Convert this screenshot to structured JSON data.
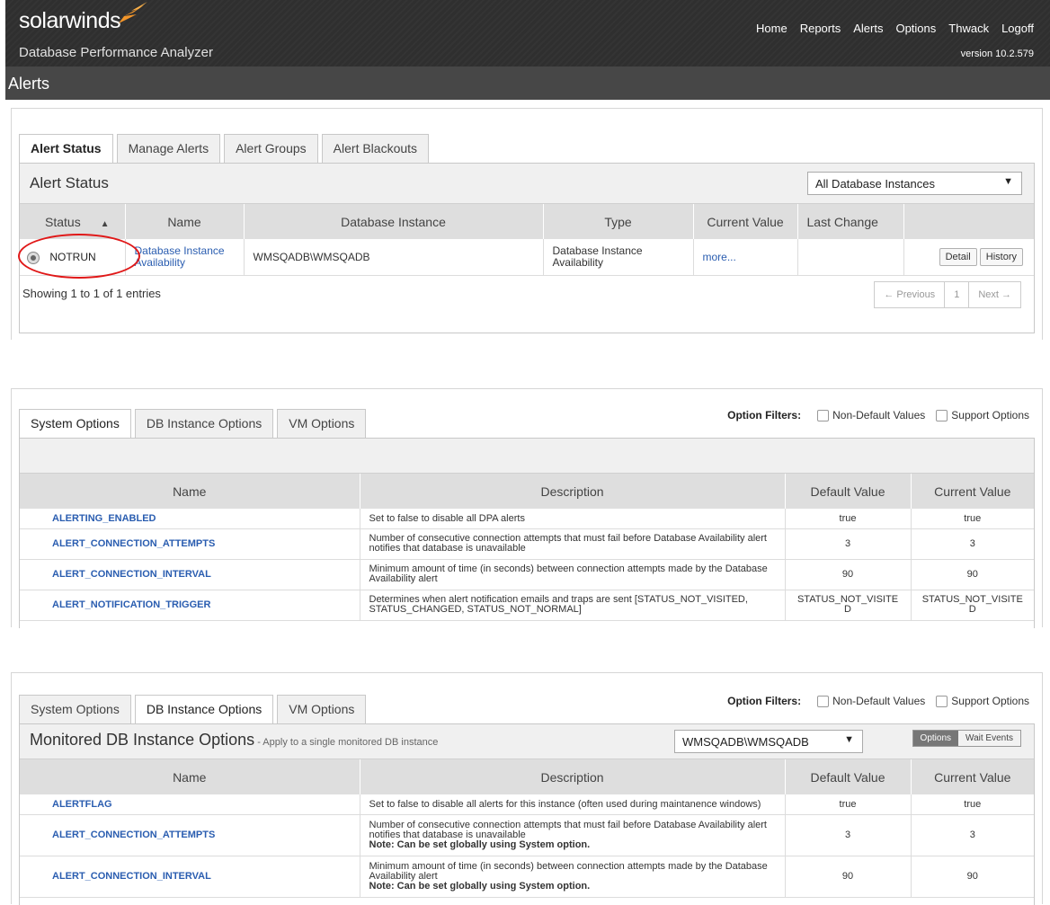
{
  "header": {
    "brand": "solarwinds",
    "product": "Database Performance Analyzer",
    "nav": [
      "Home",
      "Reports",
      "Alerts",
      "Options",
      "Thwack",
      "Logoff"
    ],
    "version": "version 10.2.579",
    "page_title": "Alerts",
    "colors": {
      "brand_flame": "#f3962a",
      "header_bg": "#2f2f2f"
    }
  },
  "alerts_panel": {
    "tabs": [
      "Alert Status",
      "Manage Alerts",
      "Alert Groups",
      "Alert Blackouts"
    ],
    "title": "Alert Status",
    "instance_filter": "All Database Instances",
    "columns": [
      "Status",
      "Name",
      "Database Instance",
      "Type",
      "Current Value",
      "Last Change",
      ""
    ],
    "row": {
      "status": "NOTRUN",
      "name": "Database Instance Availability",
      "instance": "WMSQADB\\WMSQADB",
      "type": "Database Instance Availability",
      "current_value": "more...",
      "last_change": "",
      "detail_label": "Detail",
      "history_label": "History"
    },
    "showing": "Showing 1 to 1 of 1 entries",
    "pager": {
      "previous": "← Previous",
      "page": "1",
      "next": "Next →"
    }
  },
  "system_options": {
    "tabs": [
      "System Options",
      "DB Instance Options",
      "VM Options"
    ],
    "filters_label": "Option Filters:",
    "filter_non_default": "Non-Default Values",
    "filter_support": "Support Options",
    "columns": [
      "Name",
      "Description",
      "Default Value",
      "Current Value"
    ],
    "rows": [
      {
        "name": "ALERTING_ENABLED",
        "desc": "Set to false to disable all DPA alerts",
        "default": "true",
        "current": "true"
      },
      {
        "name": "ALERT_CONNECTION_ATTEMPTS",
        "desc": "Number of consecutive connection attempts that must fail before Database Availability alert notifies that database is unavailable",
        "default": "3",
        "current": "3"
      },
      {
        "name": "ALERT_CONNECTION_INTERVAL",
        "desc": "Minimum amount of time (in seconds) between connection attempts made by the Database Availability alert",
        "default": "90",
        "current": "90"
      },
      {
        "name": "ALERT_NOTIFICATION_TRIGGER",
        "desc": "Determines when alert notification emails and traps are sent [STATUS_NOT_VISITED, STATUS_CHANGED, STATUS_NOT_NORMAL]",
        "default": "STATUS_NOT_VISITE D",
        "current": "STATUS_NOT_VISITE D"
      }
    ]
  },
  "db_options": {
    "tabs": [
      "System Options",
      "DB Instance Options",
      "VM Options"
    ],
    "filters_label": "Option Filters:",
    "filter_non_default": "Non-Default Values",
    "filter_support": "Support Options",
    "title": "Monitored DB Instance Options",
    "subtitle": " - Apply to a single monitored DB instance",
    "instance_select": "WMSQADB\\WMSQADB",
    "toggle_options": "Options",
    "toggle_wait": "Wait Events",
    "columns": [
      "Name",
      "Description",
      "Default Value",
      "Current Value"
    ],
    "note": "Note: Can be set globally using System option.",
    "rows": [
      {
        "name": "ALERTFLAG",
        "desc": "Set to false to disable all alerts for this instance (often used during maintanence windows)",
        "default": "true",
        "current": "true"
      },
      {
        "name": "ALERT_CONNECTION_ATTEMPTS",
        "desc": "Number of consecutive connection attempts that must fail before Database Availability alert notifies that database is unavailable",
        "default": "3",
        "current": "3"
      },
      {
        "name": "ALERT_CONNECTION_INTERVAL",
        "desc": "Minimum amount of time (in seconds) between connection attempts made by the Database Availability alert",
        "default": "90",
        "current": "90"
      }
    ]
  }
}
